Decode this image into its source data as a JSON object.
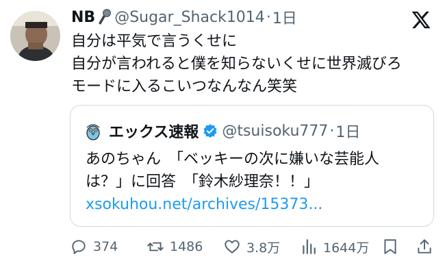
{
  "author": {
    "name": "NB",
    "handle": "@Sugar_Shack1014",
    "separator": "·",
    "time": "1日"
  },
  "tweet": {
    "lines": [
      "自分は平気で言うくせに",
      "自分が言われると僕を知らないくせに世界滅びろ",
      "モードに入るこいつなんなん笑笑"
    ]
  },
  "quote": {
    "name": "エックス速報",
    "handle": "@tsuisoku777",
    "separator": "·",
    "time": "1日",
    "lines": [
      "あのちゃん　「ベッキーの次に嫌いな芸能人",
      "は？」に回答　「鈴木紗理奈！！」"
    ],
    "link": "xsokuhou.net/archives/15373..."
  },
  "actions": {
    "replies": "374",
    "reposts": "1486",
    "likes": "3.8万",
    "views": "1644万"
  },
  "colors": {
    "text": "#0f1419",
    "secondary": "#536471",
    "link": "#1d9bf0",
    "verified": "#1d9bf0",
    "border": "#cfd9de"
  },
  "icons": [
    "microphone-icon",
    "x-logo-icon",
    "verified-badge-icon",
    "reply-icon",
    "repost-icon",
    "like-icon",
    "views-icon",
    "bookmark-icon",
    "share-icon"
  ]
}
